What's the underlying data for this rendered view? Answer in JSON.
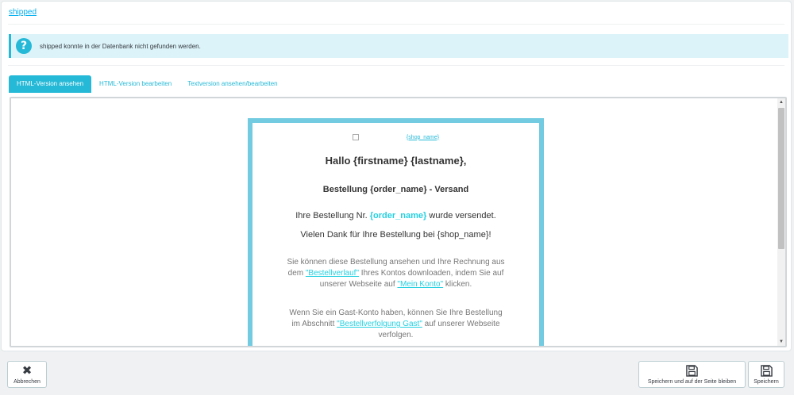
{
  "header": {
    "file_link": "shipped"
  },
  "alert": {
    "icon": "question-circle-icon",
    "text": "shipped konnte in der Datenbank nicht gefunden werden."
  },
  "tabs": [
    {
      "label": "HTML-Version ansehen",
      "active": true
    },
    {
      "label": "HTML-Version bearbeiten",
      "active": false
    },
    {
      "label": "Textversion ansehen/bearbeiten",
      "active": false
    }
  ],
  "email": {
    "logo_alt": "{shop_name}",
    "greeting": "Hallo {firstname} {lastname},",
    "subject": "Bestellung {order_name} - Versand",
    "line1_pre": "Ihre Bestellung Nr. ",
    "line1_var": "{order_name}",
    "line1_post": " wurde versendet.",
    "line2": "Vielen Dank für Ihre Bestellung bei {shop_name}!",
    "para1_a": "Sie können diese Bestellung ansehen und Ihre Rechnung aus dem ",
    "para1_link1": "\"Bestellverlauf\"",
    "para1_b": " Ihres Kontos downloaden, indem Sie auf unserer Webseite auf ",
    "para1_link2": "\"Mein Konto\"",
    "para1_c": " klicken.",
    "para2_a": "Wenn Sie ein Gast-Konto haben, können Sie Ihre Bestellung im Abschnitt ",
    "para2_link": "\"Bestellverfolgung Gast\"",
    "para2_b": " auf unserer Webseite verfolgen."
  },
  "footer": {
    "cancel_label": "Abbrechen",
    "save_stay_label": "Speichern und auf der Seite bleiben",
    "save_label": "Speichern"
  },
  "colors": {
    "accent": "#25b9d7",
    "mail_border": "#72cbe1",
    "alert_bg": "#dcf4f9"
  }
}
